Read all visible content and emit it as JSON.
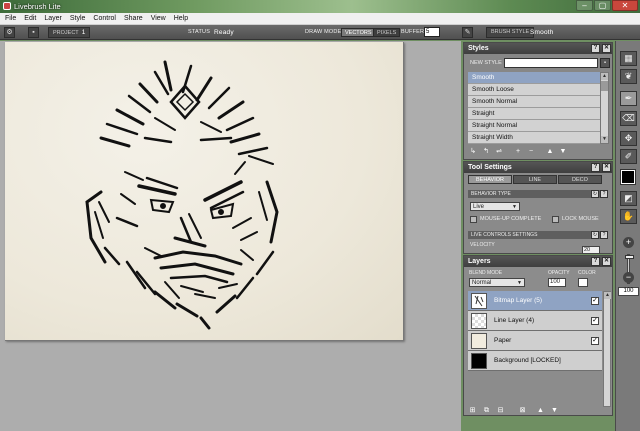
{
  "window": {
    "title": "Livebrush Lite",
    "minimize_glyph": "–",
    "maximize_glyph": "▢",
    "close_glyph": "✕"
  },
  "menu": [
    "File",
    "Edit",
    "Layer",
    "Style",
    "Control",
    "Share",
    "View",
    "Help"
  ],
  "toolbar": {
    "project_label": "PROJECT",
    "project_value": "1",
    "status_label": "STATUS",
    "status_value": "Ready",
    "draw_mode_label": "DRAW MODE",
    "vectors_label": "VECTORS",
    "pixels_label": "PIXELS",
    "buffer_label": "BUFFER",
    "buffer_value": "5",
    "brush_style_label": "BRUSH STYLE",
    "brush_style_value": "Smooth"
  },
  "styles_panel": {
    "title": "Styles",
    "new_style_label": "NEW STYLE",
    "new_style_value": "",
    "items": [
      "Smooth",
      "Smooth Loose",
      "Smooth Normal",
      "Straight",
      "Straight Normal",
      "Straight Width"
    ],
    "selected_index": 0
  },
  "tool_settings": {
    "title": "Tool Settings",
    "tabs": [
      "BEHAVIOR",
      "LINE",
      "DECO"
    ],
    "active_tab": 0,
    "behavior_type_label": "BEHAVIOR TYPE",
    "behavior_type_value": "Live",
    "mouse_up_complete_label": "MOUSE-UP COMPLETE",
    "lock_mouse_label": "LOCK MOUSE",
    "live_controls_label": "LIVE CONTROLS SETTINGS",
    "velocity_label": "VELOCITY",
    "velocity_value": "20"
  },
  "layers_panel": {
    "title": "Layers",
    "blend_mode_label": "BLEND MODE",
    "blend_mode_value": "Normal",
    "opacity_label": "OPACITY",
    "opacity_value": "100",
    "color_label": "COLOR",
    "layers": [
      {
        "name": "Bitmap Layer (5)",
        "visible": true,
        "selected": true
      },
      {
        "name": "Line Layer (4)",
        "visible": true,
        "selected": false
      },
      {
        "name": "Paper",
        "visible": true,
        "selected": false
      },
      {
        "name": "Background [LOCKED]",
        "visible": false,
        "selected": false
      }
    ]
  },
  "tools": {
    "zoom_value": "100",
    "active_color": "#000000"
  },
  "colors": {
    "selection": "#8fa3c3",
    "panel": "#7b7b7b",
    "paper": "#ede8da"
  }
}
